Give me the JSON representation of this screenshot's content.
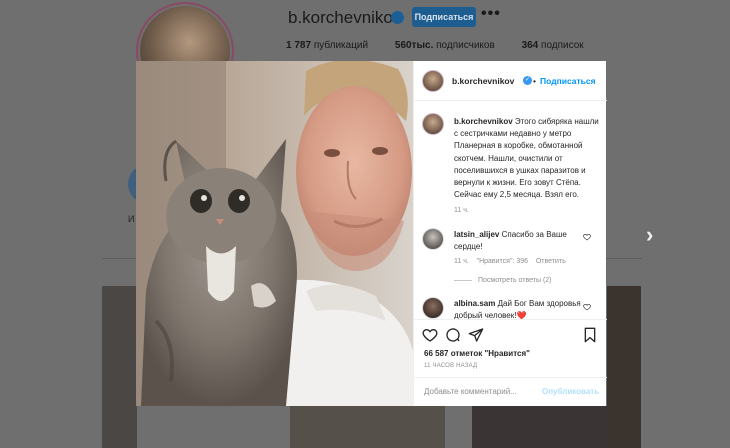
{
  "profile": {
    "username": "b.korchevnikov",
    "follow_label": "Подписаться",
    "more_label": "•••",
    "stats": {
      "posts_value": "1 787",
      "posts_label": "публикаций",
      "followers_value": "560тыс.",
      "followers_label": "подписчиков",
      "following_value": "364",
      "following_label": "подписок"
    },
    "highlight_label": "И"
  },
  "post": {
    "header": {
      "username": "b.korchevnikov",
      "separator": "•",
      "follow_label": "Подписаться"
    },
    "caption": {
      "username": "b.korchevnikov",
      "text": "Этого сибяряка нашли с сестричками недавно у метро Планерная в коробке, обмотанной скотчем. Нашли, очистили от поселившихся в ушках паразитов и вернули к жизни. Его зовут Стёпа. Сейчас ему 2,5 месяца. Взял его.",
      "time": "11 ч."
    },
    "comments": [
      {
        "username": "latsin_alijev",
        "text": "Спасибо за Ваше сердце!",
        "time": "11 ч.",
        "likes": "\"Нравится\": 396",
        "reply": "Ответить",
        "view_replies": "Посмотреть ответы (2)"
      },
      {
        "username": "albina.sam",
        "text": "Дай Бог Вам здоровья добрый человек!",
        "emoji": "❤️"
      }
    ],
    "likes_text": "66 587 отметок \"Нравится\"",
    "posted_ago": "11 ЧАСОВ НАЗАД",
    "comment_placeholder": "Добавьте комментарий...",
    "publish_label": "Опубликовать"
  },
  "colors": {
    "accent": "#0095f6",
    "muted": "#8e8e8e",
    "like_heart": "#ed4956"
  },
  "icons": [
    "verified-icon",
    "heart-icon",
    "comment-icon",
    "share-icon",
    "bookmark-icon",
    "more-icon",
    "next-arrow-icon"
  ]
}
